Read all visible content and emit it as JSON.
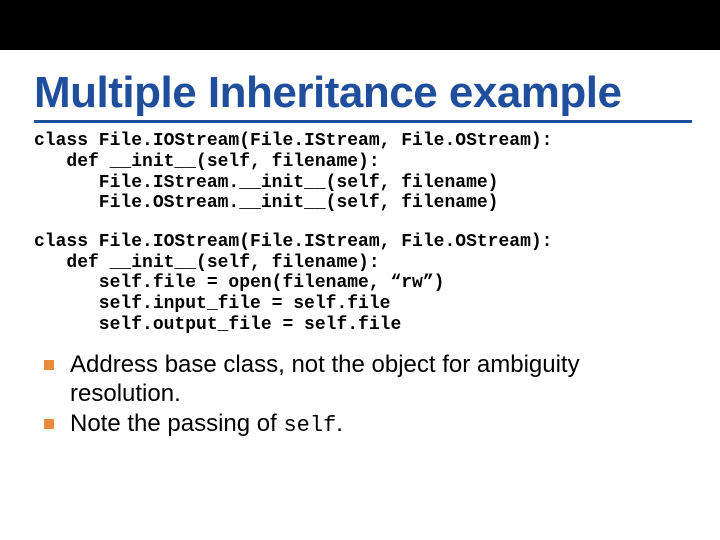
{
  "title": "Multiple Inheritance example",
  "code1": {
    "l1": "class File.IOStream(File.IStream, File.OStream):",
    "l2": "   def __init__(self, filename):",
    "l3": "      File.IStream.__init__(self, filename)",
    "l4": "      File.OStream.__init__(self, filename)"
  },
  "code2": {
    "l1": "class File.IOStream(File.IStream, File.OStream):",
    "l2": "   def __init__(self, filename):",
    "l3": "      self.file = open(filename, “rw”)",
    "l4": "      self.input_file = self.file",
    "l5": "      self.output_file = self.file"
  },
  "bullets": {
    "b1a": "Address base class, not the object for ambiguity",
    "b1b": "resolution.",
    "b2a": "Note the passing of ",
    "b2b": "self",
    "b2c": "."
  }
}
